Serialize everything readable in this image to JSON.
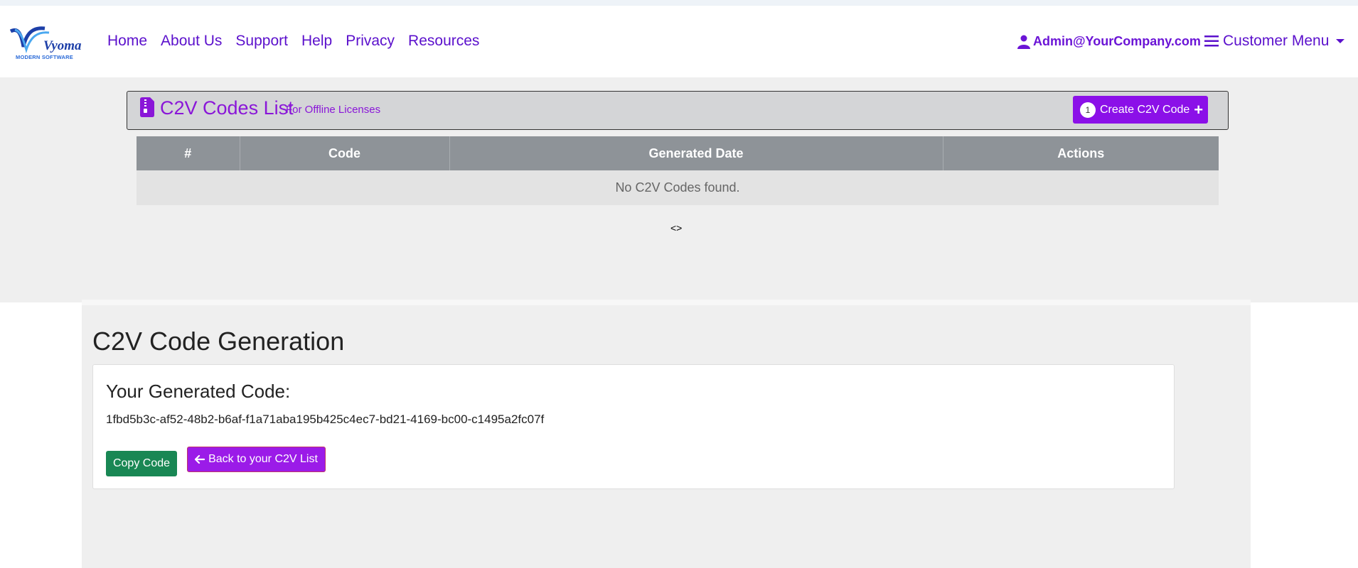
{
  "brand": {
    "logo_text": "Vyoma",
    "logo_subtext": "MODERN SOFTWARE"
  },
  "nav": {
    "links": [
      "Home",
      "About Us",
      "Support",
      "Help",
      "Privacy",
      "Resources"
    ],
    "user_email": "Admin@YourCompany.com",
    "customer_menu_label": "Customer Menu"
  },
  "codes_list": {
    "title": "C2V Codes List",
    "subtitle": "For Offline Licenses",
    "create_button": {
      "badge": "1",
      "label": "Create C2V Code"
    },
    "columns": [
      "#",
      "Code",
      "Generated Date",
      "Actions"
    ],
    "empty_message": "No C2V Codes found.",
    "pager_text": "<>"
  },
  "generation": {
    "title": "C2V Code Generation",
    "card_title": "Your Generated Code:",
    "code_value": "1fbd5b3c-af52-48b2-b6af-f1a71aba195b425c4ec7-bd21-4169-bc00-c1495a2fc07f",
    "copy_button": "Copy Code",
    "back_button": "Back to your C2V List"
  },
  "colors": {
    "accent_purple": "#8b10e8",
    "nav_link": "#5b10cc",
    "copy_green": "#198754",
    "table_header": "#8e9398"
  }
}
